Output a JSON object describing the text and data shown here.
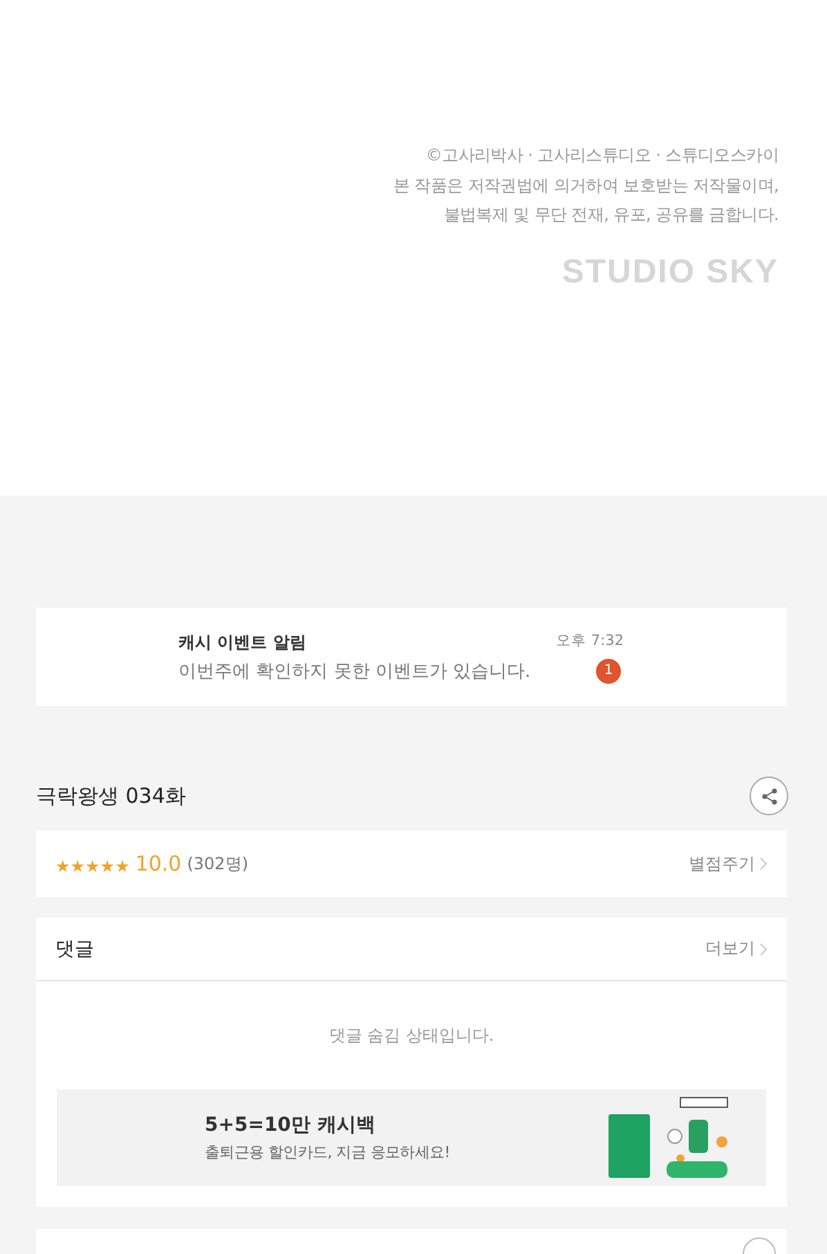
{
  "copyright": {
    "lines": [
      "©고사리박사 · 고사리스튜디오 · 스튜디오스카이",
      "본 작품은 저작권법에 의거하여 보호받는 저작물이며,",
      "불법복제 및 무단 전재, 유포, 공유를 금합니다."
    ],
    "logo": "STUDIO SKY"
  },
  "notification": {
    "title": "캐시 이벤트 알림",
    "message": "이번주에 확인하지 못한 이벤트가 있습니다.",
    "time": "오후 7:32",
    "badge": "1"
  },
  "episode": {
    "title": "극락왕생 034화"
  },
  "rating": {
    "stars": 5,
    "score": "10.0",
    "count": "(302명)",
    "action": "별점주기"
  },
  "comments": {
    "title": "댓글",
    "more": "더보기",
    "empty": "댓글 숨김 상태입니다."
  },
  "ad": {
    "title": "5+5=10만 캐시백",
    "subtitle": "출퇴근용 할인카드, 지금 응모하세요!"
  }
}
